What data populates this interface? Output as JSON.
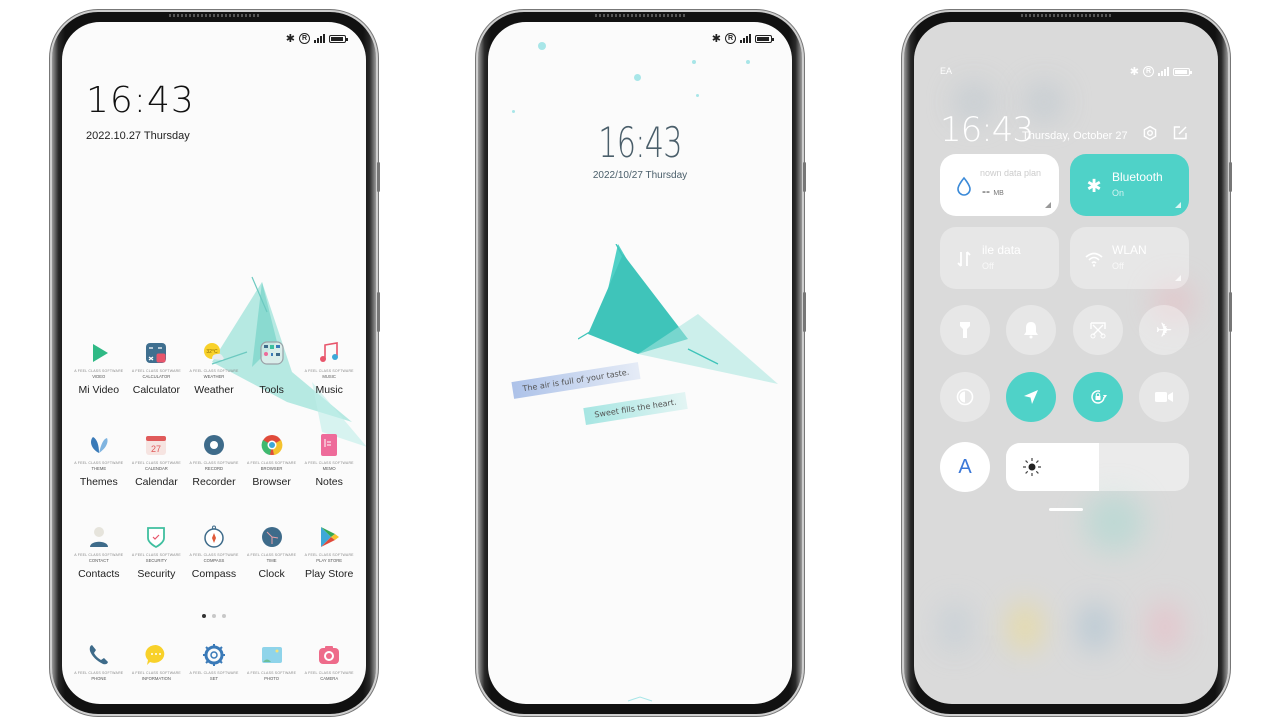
{
  "status_bar": {
    "bluetooth": "bluetooth-icon",
    "registered": "R",
    "network": "E",
    "carrier": "EA"
  },
  "home": {
    "time": "16:43",
    "date": "2022.10.27 Thursday",
    "tiny_caption": "A FEEL CLASS SOFTWARE",
    "rows": [
      [
        {
          "label": "Mi Video",
          "tag": "VIDEO",
          "icon": "play-icon",
          "color": "#2fb985"
        },
        {
          "label": "Calculator",
          "tag": "CALCULATOR",
          "icon": "calculator-icon",
          "color": "#3f6f8f"
        },
        {
          "label": "Weather",
          "tag": "WEATHER",
          "icon": "weather-icon",
          "color": "#f8d12a",
          "value": "32°C"
        },
        {
          "label": "Tools",
          "tag": "",
          "icon": "folder-icon",
          "color": "#9aa0a6"
        },
        {
          "label": "Music",
          "tag": "MUSIC",
          "icon": "music-note-icon",
          "color": "#e8556b"
        }
      ],
      [
        {
          "label": "Themes",
          "tag": "THEME",
          "icon": "petal-icon",
          "color": "#3a7ab8"
        },
        {
          "label": "Calendar",
          "tag": "CALENDAR",
          "icon": "calendar-icon",
          "color": "#e05a5a",
          "value": "27"
        },
        {
          "label": "Recorder",
          "tag": "RECORD",
          "icon": "record-icon",
          "color": "#3e6b8a"
        },
        {
          "label": "Browser",
          "tag": "BROWSER",
          "icon": "browser-icon",
          "color": "#3ea8d8"
        },
        {
          "label": "Notes",
          "tag": "MEMO",
          "icon": "notes-icon",
          "color": "#ee6b9a"
        }
      ],
      [
        {
          "label": "Contacts",
          "tag": "CONTACT",
          "icon": "person-icon",
          "color": "#3e6b8a"
        },
        {
          "label": "Security",
          "tag": "SECURITY",
          "icon": "shield-icon",
          "color": "#3fbf9f"
        },
        {
          "label": "Compass",
          "tag": "COMPASS",
          "icon": "compass-icon",
          "color": "#3e6b8a"
        },
        {
          "label": "Clock",
          "tag": "TIME",
          "icon": "clock-icon",
          "color": "#3e6b8a"
        },
        {
          "label": "Play Store",
          "tag": "PLAY STORE",
          "icon": "play-store-icon",
          "color": "#34a853"
        }
      ]
    ],
    "pages": {
      "count": 3,
      "active": 1
    },
    "dock": [
      {
        "tag": "PHONE",
        "icon": "phone-icon",
        "color": "#3e6b8a"
      },
      {
        "tag": "INFORMATION",
        "icon": "message-icon",
        "color": "#f8d12a"
      },
      {
        "tag": "SET",
        "icon": "settings-icon",
        "color": "#3a7ab8"
      },
      {
        "tag": "PHOTO",
        "icon": "photo-icon",
        "color": "#8fd4ea"
      },
      {
        "tag": "CAMERA",
        "icon": "camera-icon",
        "color": "#ee6b8a"
      }
    ]
  },
  "lock": {
    "time": "16:43",
    "date": "2022/10/27 Thursday",
    "quote1": "The air is full of your taste.",
    "quote2": "Sweet fills the heart."
  },
  "control_center": {
    "time": "16:43",
    "date": "Thursday, October 27",
    "tiles": [
      {
        "title": "nown data plan",
        "value": "--",
        "unit": "MB",
        "icon": "droplet-icon",
        "state": "white"
      },
      {
        "title": "Bluetooth",
        "value": "On",
        "icon": "bluetooth-icon",
        "state": "active"
      },
      {
        "title": "ile data",
        "value": "Off",
        "icon": "mobile-data-icon",
        "state": "inactive"
      },
      {
        "title": "WLAN",
        "value": "Off",
        "icon": "wifi-icon",
        "state": "inactive"
      }
    ],
    "toggles": [
      {
        "name": "flashlight",
        "active": false
      },
      {
        "name": "mute",
        "active": false
      },
      {
        "name": "screenshot",
        "active": false
      },
      {
        "name": "airplane-mode",
        "active": false
      },
      {
        "name": "dark-mode",
        "active": false
      },
      {
        "name": "location",
        "active": true
      },
      {
        "name": "rotation-lock",
        "active": true
      },
      {
        "name": "screen-recorder",
        "active": false
      }
    ],
    "auto_brightness_label": "A",
    "brightness_percent": 51
  },
  "colors": {
    "accent_teal": "#4fd2c8",
    "lock_text": "#4a5e6a",
    "auto_blue": "#3b78d8"
  }
}
